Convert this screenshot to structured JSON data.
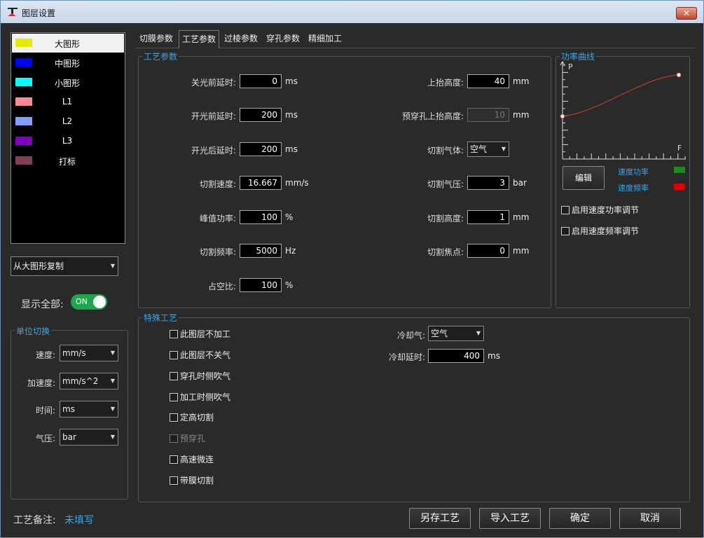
{
  "window": {
    "title": "图层设置",
    "close_label": "✕"
  },
  "layers": [
    {
      "name": "大图形",
      "color": "#e8e800",
      "selected": true
    },
    {
      "name": "中图形",
      "color": "#0000ff"
    },
    {
      "name": "小图形",
      "color": "#00ffff"
    },
    {
      "name": "L1",
      "color": "#ff8a96"
    },
    {
      "name": "L2",
      "color": "#7f9fff"
    },
    {
      "name": "L3",
      "color": "#7f00bf"
    },
    {
      "name": "打标",
      "color": "#7f3f55"
    }
  ],
  "copy_from": {
    "value": "从大图形复制"
  },
  "show_all": {
    "label": "显示全部:",
    "state": "ON"
  },
  "units": {
    "title": "单位切换",
    "speed": {
      "label": "速度:",
      "value": "mm/s"
    },
    "accel": {
      "label": "加速度:",
      "value": "mm/s^2"
    },
    "time": {
      "label": "时间:",
      "value": "ms"
    },
    "pressure": {
      "label": "气压:",
      "value": "bar"
    }
  },
  "tabs": [
    "切膜参数",
    "工艺参数",
    "过棱参数",
    "穿孔参数",
    "精细加工"
  ],
  "active_tab": 1,
  "process": {
    "title": "工艺参数",
    "off_delay": {
      "label": "关光前延时:",
      "value": "0",
      "unit": "ms"
    },
    "on_delay": {
      "label": "开光前延时:",
      "value": "200",
      "unit": "ms"
    },
    "after_delay": {
      "label": "开光后延时:",
      "value": "200",
      "unit": "ms"
    },
    "cut_speed": {
      "label": "切割速度:",
      "value": "16.667",
      "unit": "mm/s"
    },
    "peak_power": {
      "label": "峰值功率:",
      "value": "100",
      "unit": "%"
    },
    "cut_freq": {
      "label": "切割频率:",
      "value": "5000",
      "unit": "Hz"
    },
    "duty": {
      "label": "占空比:",
      "value": "100",
      "unit": "%"
    },
    "lift_height": {
      "label": "上抬高度:",
      "value": "40",
      "unit": "mm"
    },
    "prepierce_lift": {
      "label": "预穿孔上抬高度:",
      "value": "10",
      "unit": "mm"
    },
    "gas": {
      "label": "切割气体:",
      "value": "空气"
    },
    "gas_pressure": {
      "label": "切割气压:",
      "value": "3",
      "unit": "bar"
    },
    "cut_height": {
      "label": "切割高度:",
      "value": "1",
      "unit": "mm"
    },
    "focus": {
      "label": "切割焦点:",
      "value": "0",
      "unit": "mm"
    }
  },
  "power_curve": {
    "title": "功率曲线",
    "y_axis": "P",
    "x_axis": "F",
    "edit_label": "编辑",
    "legend": [
      {
        "name": "速度功率",
        "color": "#1a8a1a"
      },
      {
        "name": "速度频率",
        "color": "#e00000"
      }
    ],
    "enable_power": "启用速度功率调节",
    "enable_freq": "启用速度频率调节",
    "curve_color": "#c0392b"
  },
  "special": {
    "title": "特殊工艺",
    "options": [
      "此图层不加工",
      "此图层不关气",
      "穿孔时侧吹气",
      "加工时侧吹气",
      "定高切割",
      "预穿孔",
      "高速微连",
      "带膜切割"
    ],
    "disabled": [
      5
    ],
    "cool_gas": {
      "label": "冷却气:",
      "value": "空气"
    },
    "cool_delay": {
      "label": "冷却延时:",
      "value": "400",
      "unit": "ms"
    }
  },
  "footer": {
    "note_label": "工艺备注:",
    "note_value": "未填写",
    "save_as": "另存工艺",
    "import": "导入工艺",
    "ok": "确定",
    "cancel": "取消"
  }
}
